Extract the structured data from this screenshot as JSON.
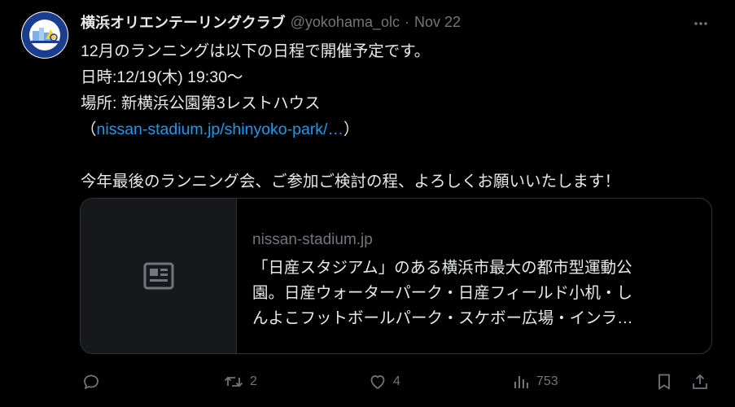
{
  "author": {
    "name": "横浜オリエンテーリングクラブ",
    "handle": "@yokohama_olc",
    "separator": "·",
    "date": "Nov 22"
  },
  "tweet": {
    "lines": [
      "12月のランニングは以下の日程で開催予定です。",
      "日時:12/19(木) 19:30〜",
      "場所: 新横浜公園第3レストハウス"
    ],
    "link_open": "（",
    "link_text": "nissan-stadium.jp/shinyoko-park/…",
    "link_close": "）",
    "closing": "今年最後のランニング会、ご参加ご検討の程、よろしくお願いいたします！"
  },
  "card": {
    "domain": "nissan-stadium.jp",
    "description_lines": [
      "「日産スタジアム」のある横浜市最大の都市型運動公",
      "園。日産ウォーターパーク・日産フィールド小机・し",
      "んよこフットボールパーク・スケボー広場・インラ…"
    ]
  },
  "actions": {
    "reply_count": "",
    "retweet_count": "2",
    "like_count": "4",
    "views_count": "753"
  },
  "colors": {
    "background": "#000000",
    "text": "#e7e9ea",
    "muted": "#71767b",
    "link": "#1d9bf0",
    "border": "#2f3336"
  },
  "icons": [
    "club-logo-avatar",
    "more-icon",
    "newspaper-icon",
    "reply-icon",
    "retweet-icon",
    "like-icon",
    "views-icon",
    "bookmark-icon",
    "share-icon"
  ]
}
